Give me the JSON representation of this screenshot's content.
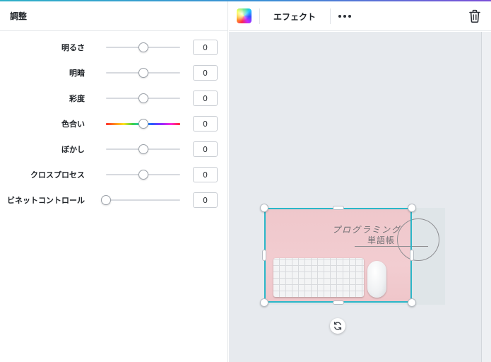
{
  "panel": {
    "title": "調整",
    "adjustments": [
      {
        "label": "明るさ",
        "value": "0",
        "slider_fraction": 0.5
      },
      {
        "label": "明暗",
        "value": "0",
        "slider_fraction": 0.5
      },
      {
        "label": "彩度",
        "value": "0",
        "slider_fraction": 0.5
      },
      {
        "label": "色合い",
        "value": "0",
        "slider_fraction": 0.5
      },
      {
        "label": "ぼかし",
        "value": "0",
        "slider_fraction": 0.5
      },
      {
        "label": "クロスプロセス",
        "value": "0",
        "slider_fraction": 0.5
      },
      {
        "label": "ビネットコントロール",
        "value": "0",
        "slider_fraction": 0.0
      }
    ]
  },
  "toolbar": {
    "effect_label": "エフェクト"
  },
  "canvas": {
    "image_text_line1": "プログラミング",
    "image_text_line2": "単語帳"
  },
  "colors": {
    "accent": "#2ab7c8",
    "canvas_bg": "#e7eaee",
    "image_pink": "#f2cdd1"
  },
  "icons": {
    "color": "color-swatch-icon",
    "more": "more-dots-icon",
    "delete": "trash-icon",
    "rotate": "rotate-icon"
  }
}
